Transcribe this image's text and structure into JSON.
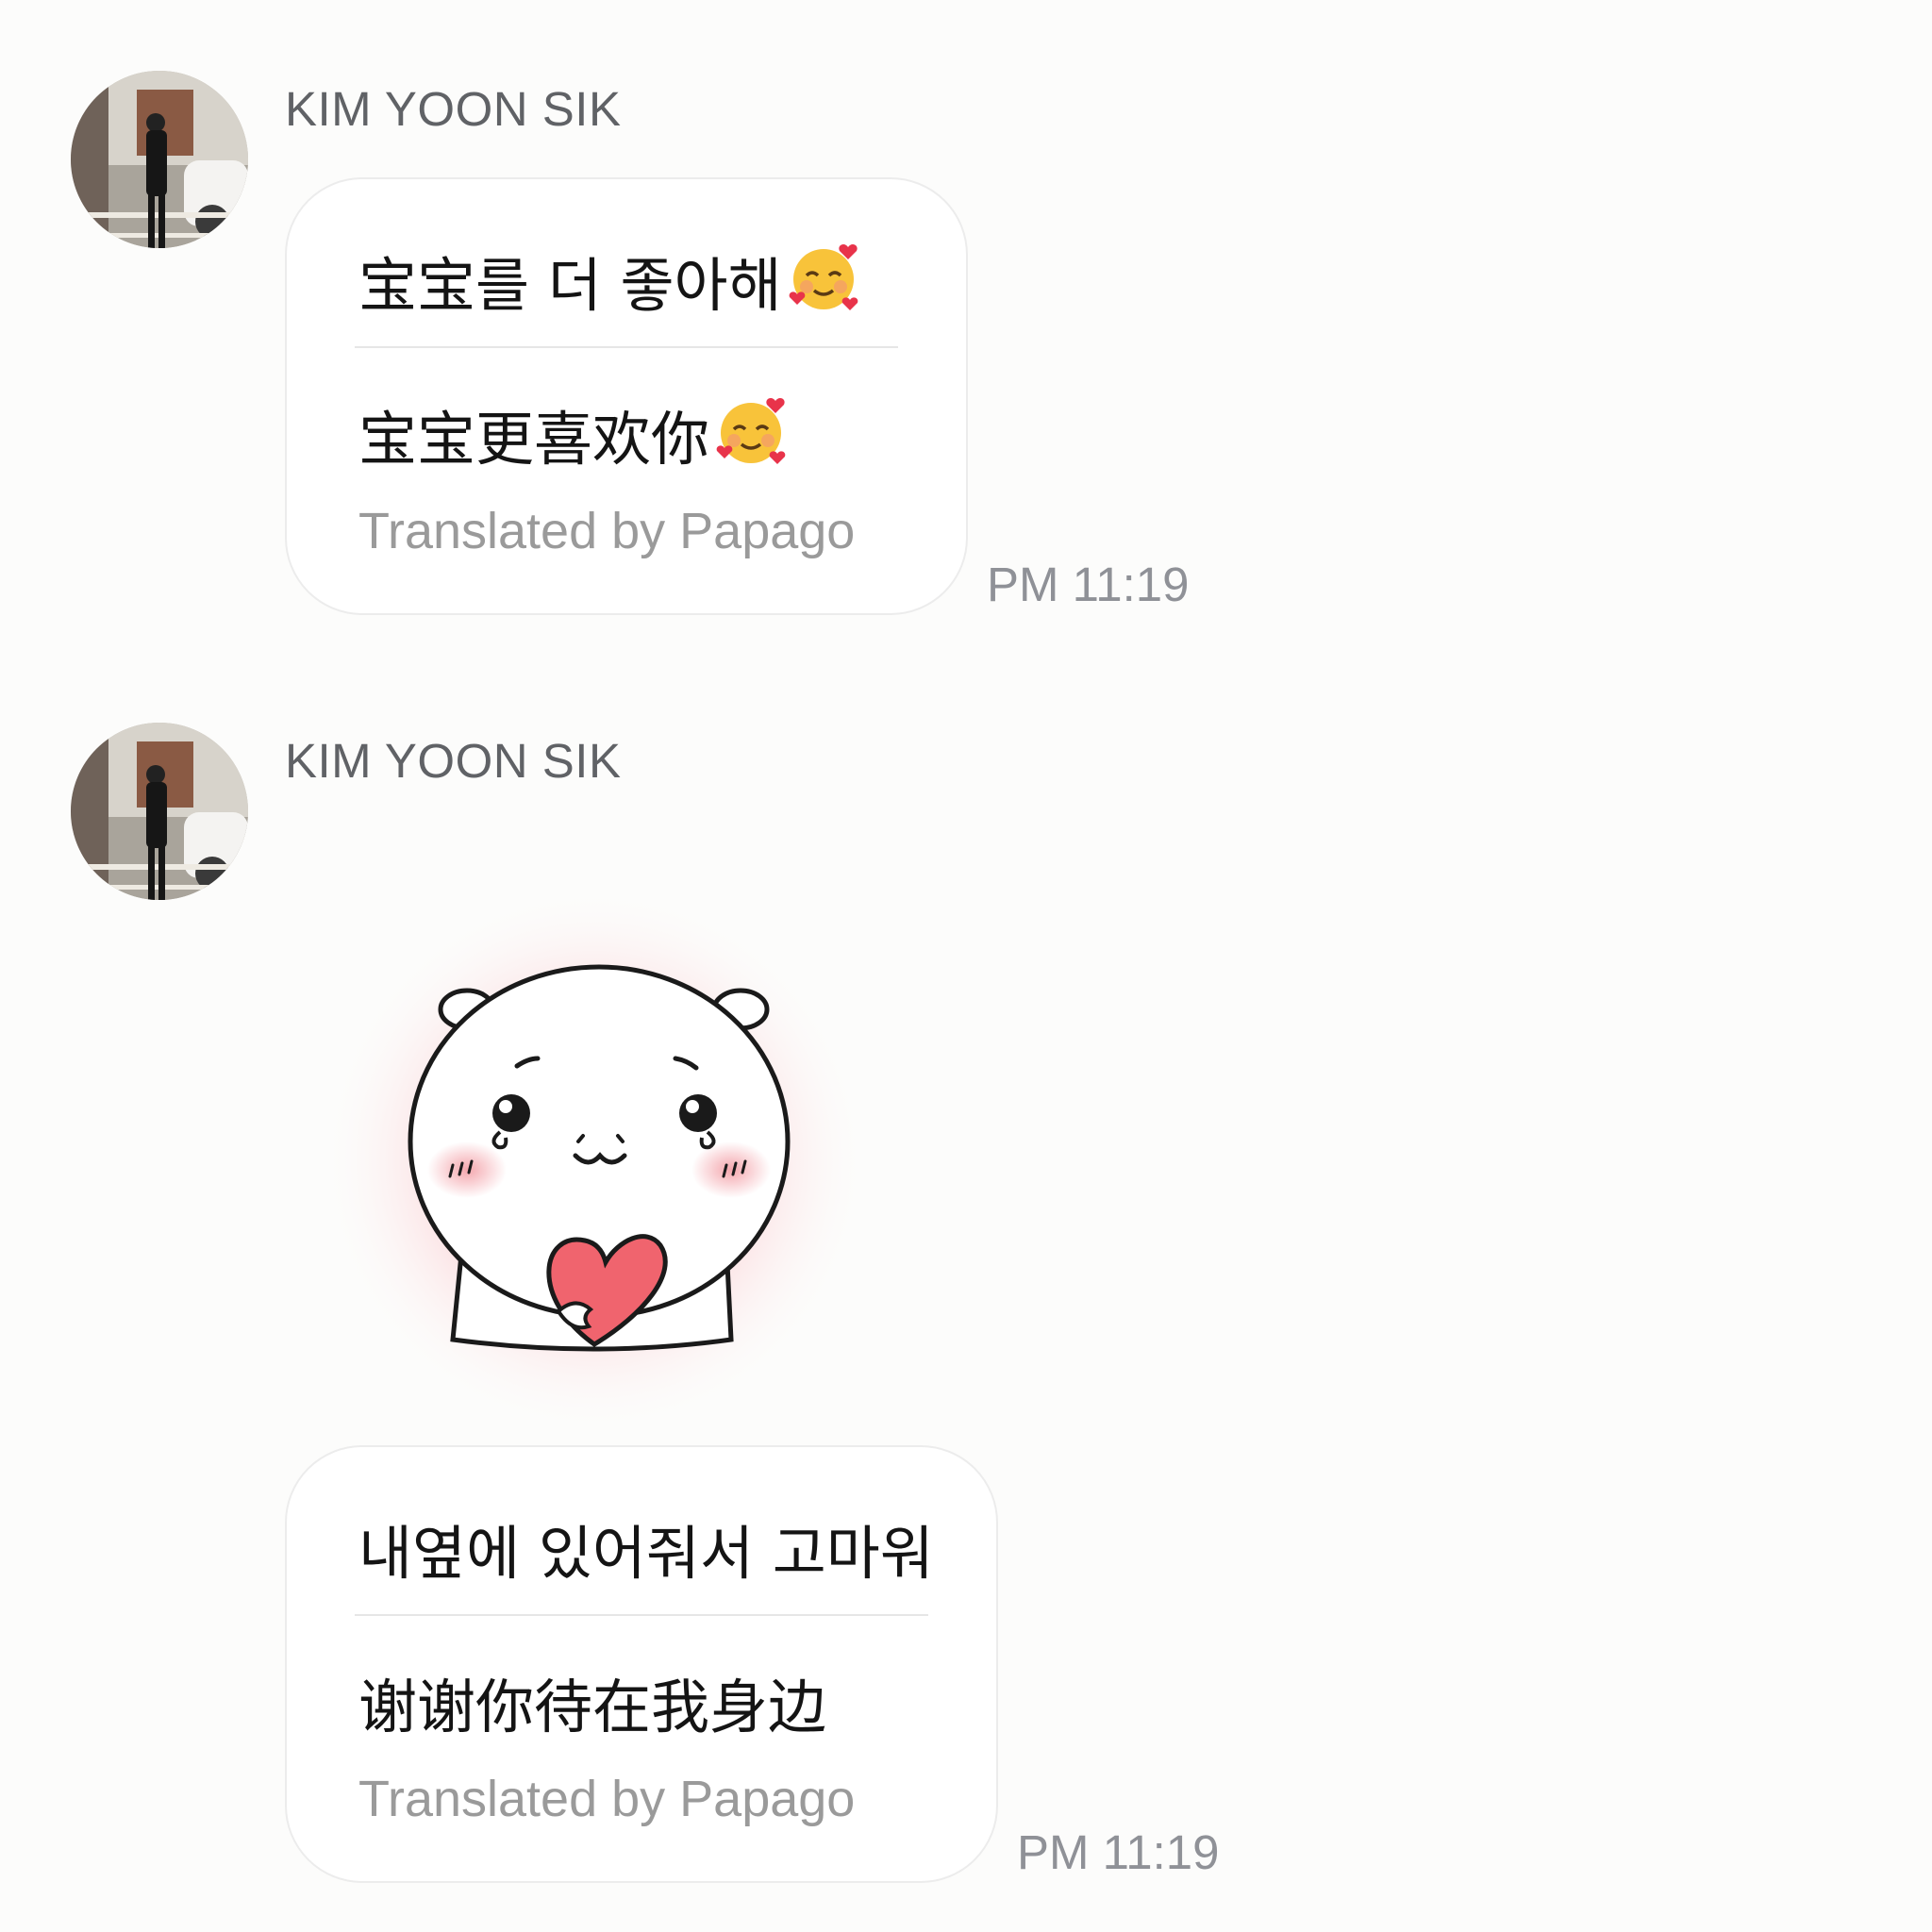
{
  "chat": {
    "messages": [
      {
        "sender": "KIM YOON SIK",
        "original": "宝宝를 더 좋아해",
        "translated": "宝宝更喜欢你",
        "credit": "Translated by Papago",
        "time": "PM 11:19",
        "emoji": "smiling-face-with-hearts"
      },
      {
        "sender": "KIM YOON SIK",
        "sticker": "hamster-holding-heart-sticker",
        "original": "내옆에 있어줘서 고마워",
        "translated": "谢谢你待在我身边",
        "credit": "Translated by Papago",
        "time": "PM 11:19"
      }
    ]
  },
  "colors": {
    "background": "#fcfcfb",
    "bubble": "#ffffff",
    "sender_text": "#606266",
    "time_text": "#8f9197",
    "credit_text": "#9a9a9a",
    "blush": "#f4a6ad",
    "heart": "#f0646e"
  }
}
